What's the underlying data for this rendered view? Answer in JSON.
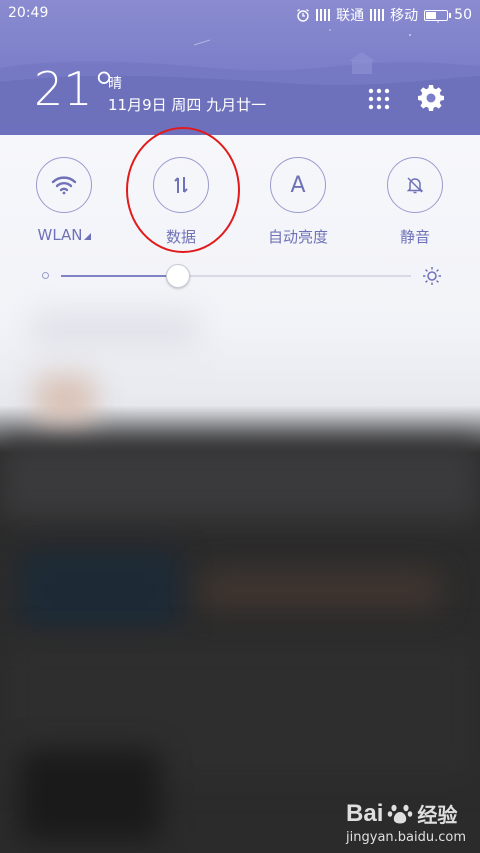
{
  "status_bar": {
    "time": "20:49",
    "carrier1": "联通",
    "carrier2": "移动",
    "battery": "50",
    "battery_level": 0.5
  },
  "weather": {
    "temperature": "21°",
    "condition": "晴",
    "date": "11月9日 周四 九月廿一"
  },
  "toggles": [
    {
      "label": "WLAN",
      "icon": "wifi-icon"
    },
    {
      "label": "数据",
      "icon": "data-arrows-icon"
    },
    {
      "label": "自动亮度",
      "icon": "auto-brightness-icon",
      "glyph": "A"
    },
    {
      "label": "静音",
      "icon": "bell-off-icon"
    }
  ],
  "brightness": {
    "level": 0.33
  },
  "colors": {
    "accent": "#6f72b8",
    "highlight_ring": "#e11b1b",
    "header": "#7b7ec8"
  },
  "watermark": {
    "brand": "Bai",
    "brand2": "经验",
    "url": "jingyan.baidu.com"
  }
}
